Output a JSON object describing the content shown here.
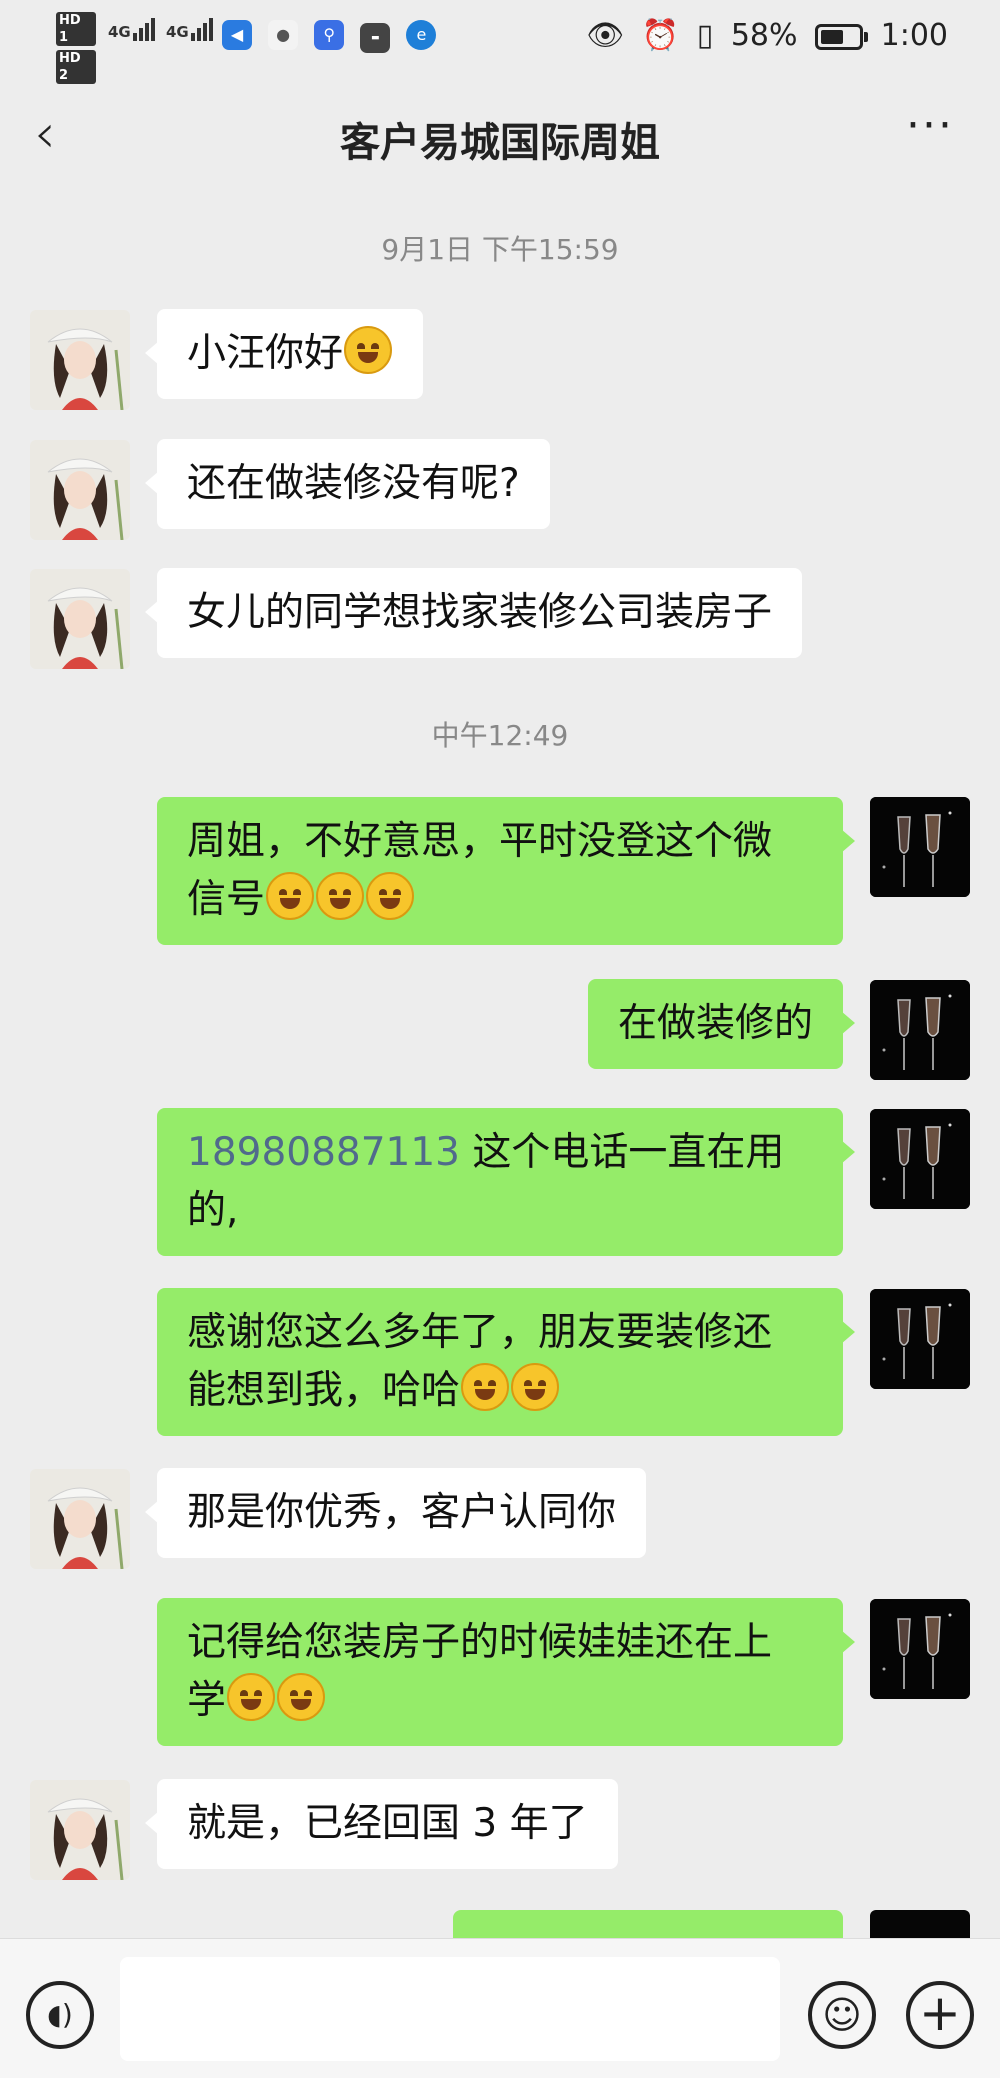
{
  "status_bar": {
    "hd1": "HD 1",
    "hd2": "HD 2",
    "net1": "4G",
    "net2": "4G",
    "battery_percent": "58%",
    "time": "1:00",
    "icons": [
      "messenger-icon",
      "wechat-icon",
      "baidu-icon",
      "huawei-icon",
      "browser-icon",
      "eye-icon",
      "alarm-icon",
      "vibrate-icon",
      "battery-icon"
    ]
  },
  "header": {
    "title": "客户易城国际周姐",
    "back_label": "‹",
    "more_label": "···"
  },
  "chat": {
    "timestamps": [
      "9月1日 下午15:59",
      "中午12:49"
    ],
    "messages": [
      {
        "side": "in",
        "text": "小汪你好"
      },
      {
        "side": "in",
        "text": "还在做装修没有呢?"
      },
      {
        "side": "in",
        "text": "女儿的同学想找家装修公司装房子"
      },
      {
        "side": "out",
        "line1": "周姐，不好意思，平时没登这个微",
        "line2": "信号"
      },
      {
        "side": "out",
        "text": "在做装修的"
      },
      {
        "side": "out",
        "phone": "18980887113",
        "line1_rest": " 这个电话一直在用",
        "line2": "的,"
      },
      {
        "side": "out",
        "line1": "感谢您这么多年了，朋友要装修还",
        "line2": "能想到我，哈哈"
      },
      {
        "side": "in",
        "text": "那是你优秀，客户认同你"
      },
      {
        "side": "out",
        "line1": "记得给您装房子的时候娃娃还在上",
        "line2": "学"
      },
      {
        "side": "in",
        "text": "就是，已经回国 3 年了"
      }
    ]
  },
  "input_bar": {
    "placeholder": ""
  },
  "colors": {
    "background": "#ededed",
    "outgoing_bubble": "#95ec69",
    "incoming_bubble": "#ffffff",
    "phone_link": "#506a8c"
  }
}
